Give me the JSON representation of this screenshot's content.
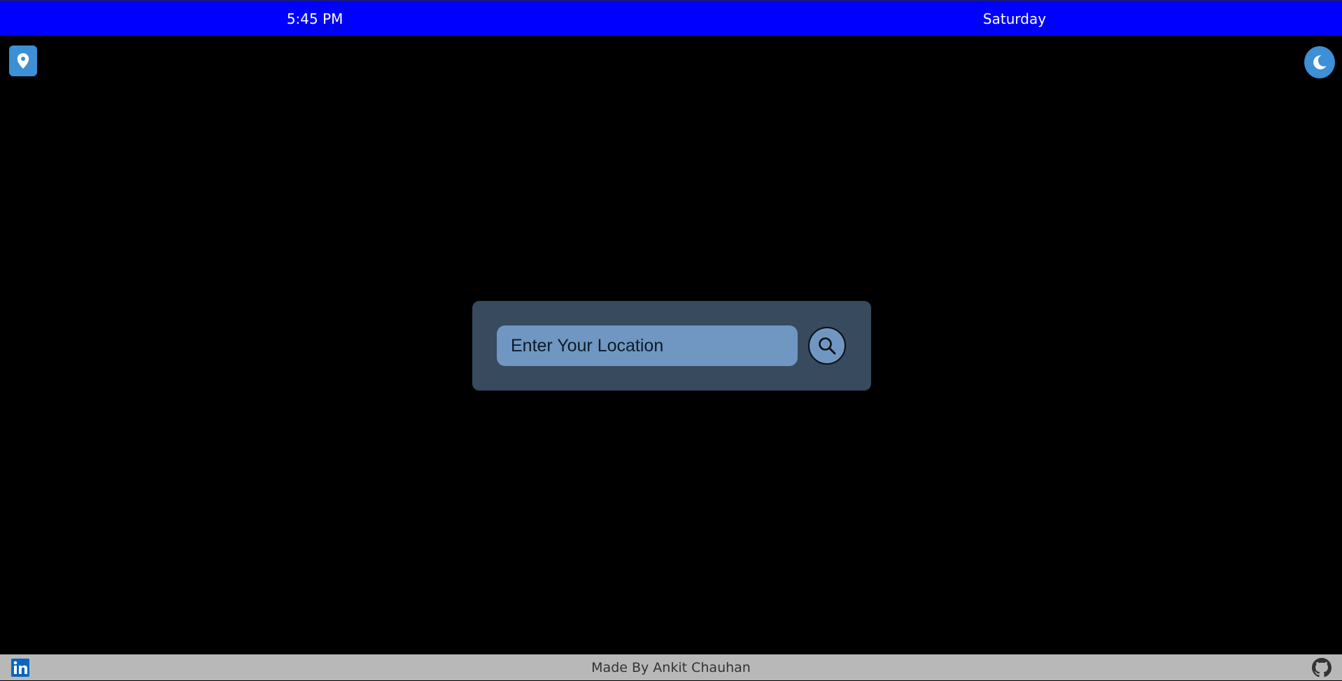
{
  "header": {
    "time": "5:45 PM",
    "day": "Saturday"
  },
  "controls": {
    "location_icon": "map-pin-icon",
    "theme_icon": "moon-icon"
  },
  "search": {
    "placeholder": "Enter Your Location",
    "value": "",
    "button_icon": "search-icon"
  },
  "footer": {
    "credit": "Made By Ankit Chauhan",
    "left_icon": "linkedin-icon",
    "right_icon": "github-icon"
  },
  "colors": {
    "header_bg": "#0000ff",
    "page_bg": "#000000",
    "accent": "#3d8fd6",
    "card_bg": "#374a5e",
    "input_bg": "#7097c1",
    "footer_bg": "#b8b8b8"
  }
}
